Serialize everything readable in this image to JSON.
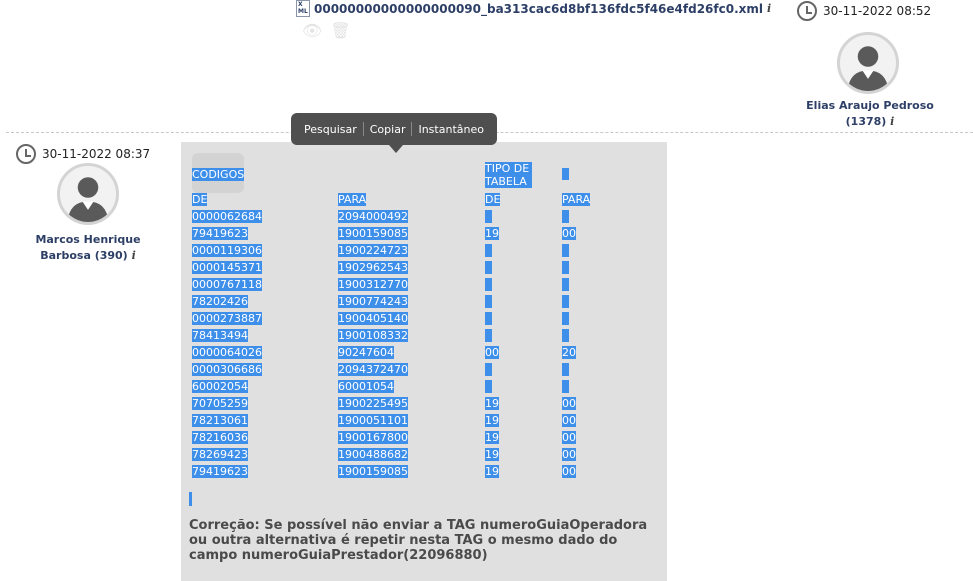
{
  "top_message": {
    "file_name": "00000000000000000090_ba313cac6d8bf136fdc5f46e4fd26fc0.xml",
    "timestamp": "30-11-2022 08:52",
    "user_name": "Elias Araujo Pedroso",
    "user_id": "(1378)"
  },
  "context_menu": {
    "items": [
      "Pesquisar",
      "Copiar",
      "Instantâneo"
    ]
  },
  "message": {
    "timestamp": "30-11-2022 08:37",
    "user_name_line1": "Marcos Henrique",
    "user_name_line2": "Barbosa (390)",
    "table": {
      "group_headers": [
        "CODIGOS",
        "",
        "TIPO DE TABELA",
        ""
      ],
      "sub_headers": [
        "DE",
        "PARA",
        "DE",
        "PARA"
      ],
      "rows": [
        [
          "0000062684",
          "2094000492",
          "",
          ""
        ],
        [
          "79419623",
          "1900159085",
          "19",
          "00"
        ],
        [
          "0000119306",
          "1900224723",
          "",
          ""
        ],
        [
          "0000145371",
          "1902962543",
          "",
          ""
        ],
        [
          "0000767118",
          "1900312770",
          "",
          ""
        ],
        [
          "78202426",
          "1900774243",
          "",
          ""
        ],
        [
          "0000273887",
          "1900405140",
          "",
          ""
        ],
        [
          "78413494",
          "1900108332",
          "",
          ""
        ],
        [
          "0000064026",
          "90247604",
          "00",
          "20"
        ],
        [
          "0000306686",
          "2094372470",
          "",
          ""
        ],
        [
          "60002054",
          "60001054",
          "",
          ""
        ],
        [
          "70705259",
          "1900225495",
          "19",
          "00"
        ],
        [
          "78213061",
          "1900051101",
          "19",
          "00"
        ],
        [
          "78216036",
          "1900167800",
          "19",
          "00"
        ],
        [
          "78269423",
          "1900488682",
          "19",
          "00"
        ],
        [
          "79419623",
          "1900159085",
          "19",
          "00"
        ]
      ]
    },
    "correction_text": "Correção: Se possível não enviar a TAG numeroGuiaOperadora ou outra alternativa é repetir nesta TAG o mesmo dado do campo numeroGuiaPrestador(22096880)"
  },
  "colors": {
    "selection": "#3e8fea",
    "bubble": "#e0e0e0",
    "link": "#2d3f66"
  }
}
